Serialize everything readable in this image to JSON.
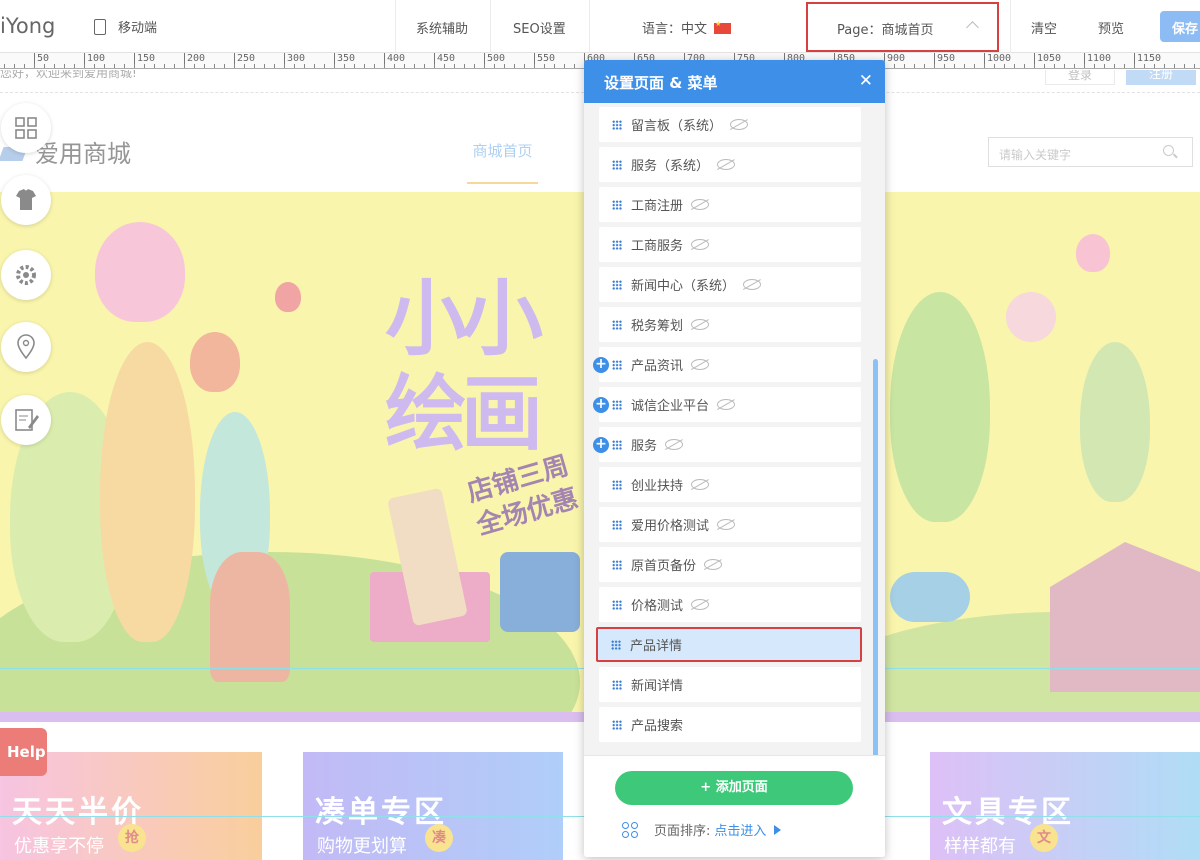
{
  "topbar": {
    "logo": "iYong",
    "mobile_label": "移动端",
    "assist": "系统辅助",
    "seo": "SEO设置",
    "language_label": "语言：中文",
    "page_selector": "Page：商城首页",
    "clear": "清空",
    "preview": "预览",
    "save": "保存"
  },
  "ruler": {
    "marks": [
      "50",
      "100",
      "150",
      "200",
      "250",
      "300",
      "350",
      "400",
      "450",
      "500",
      "550",
      "600",
      "650",
      "700",
      "750",
      "800",
      "850",
      "900",
      "950",
      "1000",
      "1050",
      "1100",
      "1150"
    ]
  },
  "site": {
    "welcome": "您好，欢迎来到爱用商城!",
    "login": "登录",
    "register": "注册",
    "shop_name": "爱用商城",
    "nav_home": "商城首页",
    "search_placeholder": "请输入关键字",
    "banner_title": "小小绘画",
    "banner_sub1": "店铺三周",
    "banner_sub2": "全场优惠",
    "help": "Help"
  },
  "cards": [
    {
      "title": "天天半价",
      "sub": "优惠享不停",
      "tag": "抢",
      "color1": "#f3a0d0",
      "color2": "#f6b15f"
    },
    {
      "title": "凑单专区",
      "sub": "购物更划算",
      "tag": "凑",
      "color1": "#9d8ff0",
      "color2": "#7fb0f5"
    },
    {
      "title": "文具专区",
      "sub": "样样都有",
      "tag": "文",
      "color1": "#c99af0",
      "color2": "#7fc8f0"
    }
  ],
  "modal": {
    "title": "设置页面 & 菜单",
    "items": [
      {
        "label": "留言板（系统）",
        "eye": true,
        "plus": false,
        "active": false
      },
      {
        "label": "服务（系统）",
        "eye": true,
        "plus": false,
        "active": false
      },
      {
        "label": "工商注册",
        "eye": true,
        "plus": false,
        "active": false
      },
      {
        "label": "工商服务",
        "eye": true,
        "plus": false,
        "active": false
      },
      {
        "label": "新闻中心（系统）",
        "eye": true,
        "plus": false,
        "active": false
      },
      {
        "label": "税务筹划",
        "eye": true,
        "plus": false,
        "active": false
      },
      {
        "label": "产品资讯",
        "eye": true,
        "plus": true,
        "active": false
      },
      {
        "label": "诚信企业平台",
        "eye": true,
        "plus": true,
        "active": false
      },
      {
        "label": "服务",
        "eye": true,
        "plus": true,
        "active": false
      },
      {
        "label": "创业扶持",
        "eye": true,
        "plus": false,
        "active": false
      },
      {
        "label": "爱用价格测试",
        "eye": true,
        "plus": false,
        "active": false
      },
      {
        "label": "原首页备份",
        "eye": true,
        "plus": false,
        "active": false
      },
      {
        "label": "价格测试",
        "eye": true,
        "plus": false,
        "active": false
      },
      {
        "label": "产品详情",
        "eye": false,
        "plus": false,
        "active": true
      },
      {
        "label": "新闻详情",
        "eye": false,
        "plus": false,
        "active": false
      },
      {
        "label": "产品搜索",
        "eye": false,
        "plus": false,
        "active": false
      }
    ],
    "add_button": "+ 添加页面",
    "sort_label": "页面排序:",
    "sort_link": "点击进入"
  },
  "colors": {
    "primary": "#3d8fe8",
    "add_green": "#3ec97a",
    "highlight_red": "#d64040",
    "banner_yellow": "#f6ef7a"
  }
}
